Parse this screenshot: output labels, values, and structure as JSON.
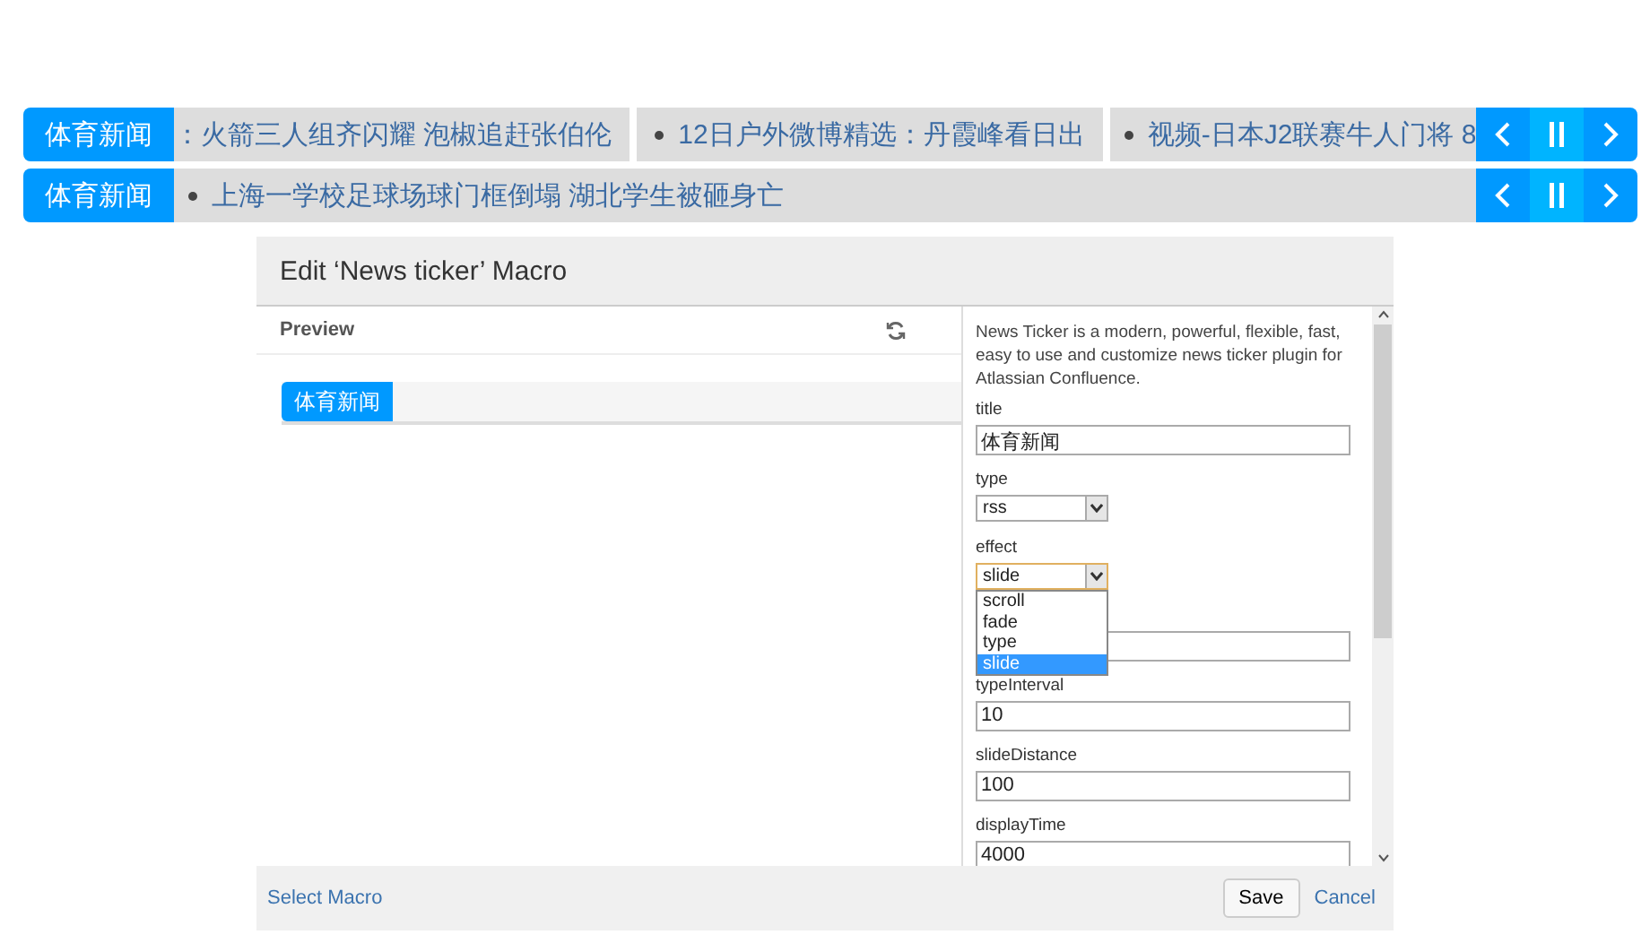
{
  "tickers": [
    {
      "title": "体育新闻",
      "items": [
        {
          "text": "：火箭三人组齐闪耀 泡椒追赶张伯伦",
          "bullet": false
        },
        {
          "text": "12日户外微博精选：丹霞峰看日出",
          "bullet": true
        },
        {
          "text": "视频-日本J2联赛牛人门将 8",
          "bullet": true
        }
      ]
    },
    {
      "title": "体育新闻",
      "items": [
        {
          "text": "上海一学校足球场球门框倒塌 湖北学生被砸身亡",
          "bullet": true
        }
      ]
    }
  ],
  "dialog": {
    "title": "Edit ‘News ticker’ Macro",
    "preview": {
      "heading": "Preview",
      "ticker_title": "体育新闻"
    },
    "description": "News Ticker is a modern, powerful, flexible, fast, easy to use and customize news ticker plugin for Atlassian Confluence.",
    "fields": [
      {
        "kind": "text",
        "label": "title",
        "value": "体育新闻"
      },
      {
        "kind": "select",
        "label": "type",
        "value": "rss"
      },
      {
        "kind": "select",
        "label": "effect",
        "value": "slide",
        "expanded": true,
        "options": [
          {
            "label": "scroll",
            "selected": false
          },
          {
            "label": "fade",
            "selected": false
          },
          {
            "label": "type",
            "selected": false
          },
          {
            "label": "slide",
            "selected": true
          }
        ]
      },
      {
        "kind": "text"
      },
      {
        "kind": "text",
        "label": "typeInterval",
        "value": "10"
      },
      {
        "kind": "text",
        "label": "slideDistance",
        "value": "100"
      },
      {
        "kind": "text",
        "label": "displayTime",
        "value": "4000"
      }
    ],
    "footer": {
      "link": "Select Macro",
      "buttons": [
        "Save",
        "Cancel"
      ]
    }
  }
}
